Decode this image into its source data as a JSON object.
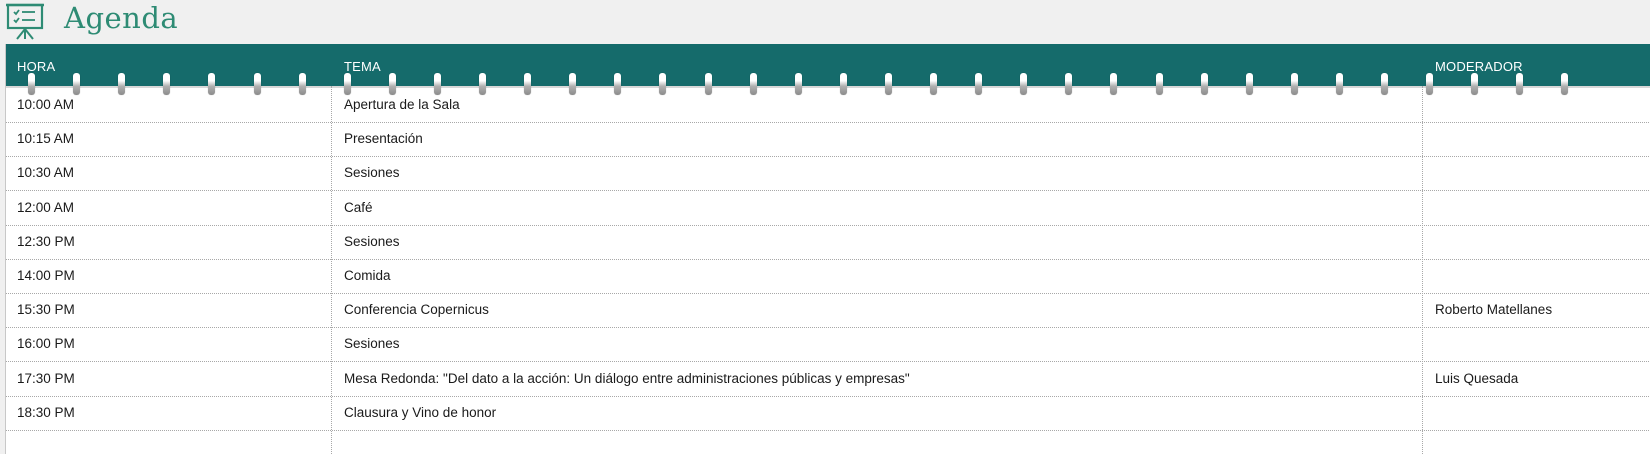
{
  "title": "Agenda",
  "colors": {
    "accent": "#2e8b74",
    "header_bg": "#156b6b",
    "header_text": "#ffffff"
  },
  "icon": "presentation-board-icon",
  "columns": {
    "hora": "HORA",
    "tema": "TEMA",
    "moderador": "MODERADOR"
  },
  "rows": [
    {
      "hora": "10:00 AM",
      "tema": "Apertura de la Sala",
      "moderador": ""
    },
    {
      "hora": "10:15 AM",
      "tema": "Presentación",
      "moderador": ""
    },
    {
      "hora": "10:30 AM",
      "tema": "Sesiones",
      "moderador": ""
    },
    {
      "hora": "12:00 AM",
      "tema": "Café",
      "moderador": ""
    },
    {
      "hora": "12:30 PM",
      "tema": "Sesiones",
      "moderador": ""
    },
    {
      "hora": "14:00 PM",
      "tema": "Comida",
      "moderador": ""
    },
    {
      "hora": "15:30 PM",
      "tema": "Conferencia Copernicus",
      "moderador": "Roberto Matellanes"
    },
    {
      "hora": "16:00 PM",
      "tema": "Sesiones",
      "moderador": ""
    },
    {
      "hora": "17:30 PM",
      "tema": "Mesa Redonda: \"Del dato a la acción: Un diálogo entre administraciones públicas y empresas\"",
      "moderador": "Luis Quesada"
    },
    {
      "hora": "18:30 PM",
      "tema": "Clausura y Vino de honor",
      "moderador": ""
    }
  ]
}
